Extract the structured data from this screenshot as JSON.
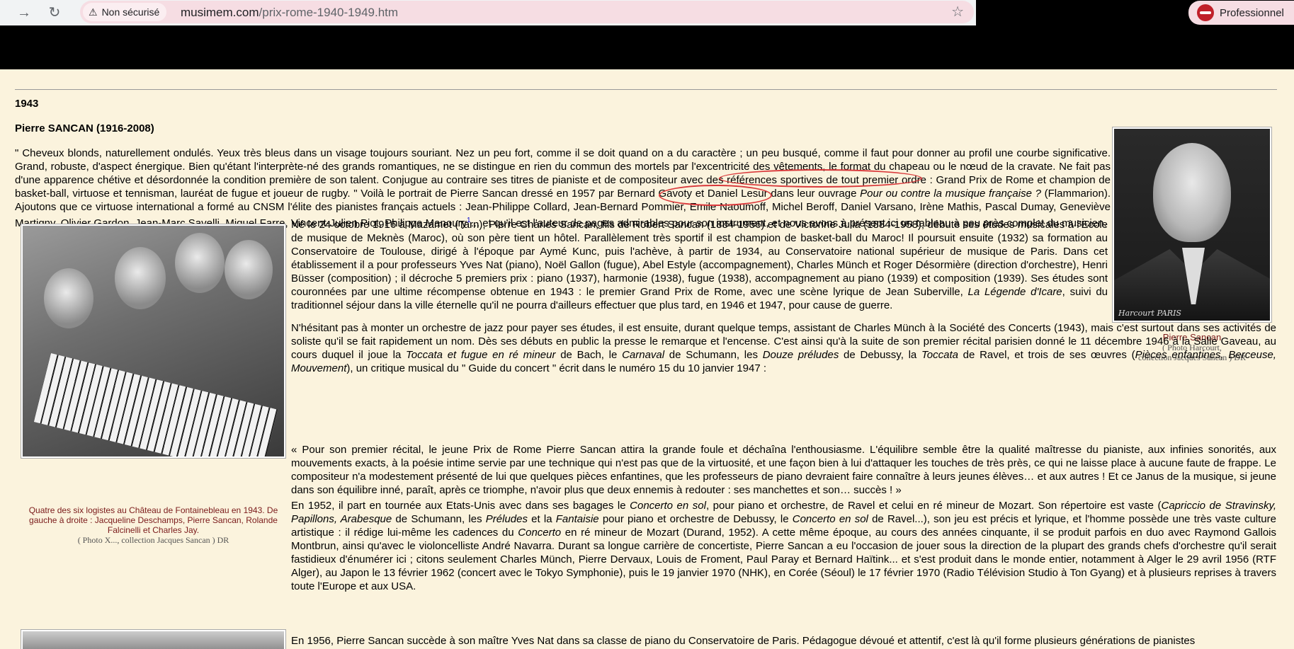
{
  "browser": {
    "security_label": "Non sécurisé",
    "url_host": "musimem.com",
    "url_path": "/prix-rome-1940-1949.htm",
    "profile_label": "Professionnel",
    "icons": [
      "forward-icon",
      "reload-icon",
      "warning-icon",
      "star-icon"
    ]
  },
  "page": {
    "year": "1943",
    "laureate": "Pierre SANCAN (1916-2008)",
    "intro": {
      "t1": "\" Cheveux blonds, naturellement ondulés. Yeux très bleus dans un visage toujours souriant. Nez un peu fort, comme il se doit quand on a du caractère ; un peu busqué, comme il faut pour donner au profil une courbe significative. Grand, robuste, d'aspect énergique. Bien qu'étant l'interprète-né des grands romantiques, ne se distingue en rien du commun des mortels par l'excentricité des vêtements, le format du chapeau ou le nœud de la cravate. Ne fait pas d'une apparence chétive et désordonnée la condition première de son talent. Conjugue au contraire ses titres de pianiste et de compositeur avec des références sportives de tout premier ordre : Grand Prix de Rome et champion de basket-ball, virtuose et tennisman, lauréat de fugue et joueur de rugby. \" Voilà le portrait de Pierre Sancan dressé en 1957 par Bernard Gavoty et Daniel Lesur dans leur ouvrage ",
      "book": "Pour ou contre la musique française ?",
      "t2": " (Flammarion). Ajoutons que ce virtuose international a formé au CNSM l'élite des pianistes français actuels : Jean-Philippe Collard, Jean-Bernard Pommier, Emile Naoumoff, Michel Beroff, Daniel Varsano, Irène Mathis, Pascal Dumay, Geneviève Martigny, Olivier Gardon, Jean-Marc Savelli, Miquel Farre, Vincent-Julien Piot, Philippe Manoury",
      "footnote": "1",
      "t3": "... et qu'il est l'auteur de pages admirables pour son instrument, et nous avons à présent ici un tableau à peu près complet du musicien."
    },
    "portrait": {
      "signature": "Harcourt PARIS",
      "caption_name": "Pierre Sancan",
      "caption_credit1": "( Photo Harcourt,",
      "caption_credit2": "collection Jacques Sancan ) DR"
    },
    "bio": {
      "t1": "Né le 24 octobre 1916 à Mazamet (Tarn), Pierre Charles Sancan, fils de Robert Sancan (1884-1956) et de Victorine Julia (1884-1958), débute ses études musicales à l'Ecole de musique de Meknès (Maroc), où son père tient un hôtel. Parallèlement très sportif il est champion de basket-ball du Maroc! Il poursuit ensuite (1932) sa formation au Conservatoire de Toulouse, dirigé à l'époque par Aymé Kunc, puis l'achève, à partir de 1934, au Conservatoire national supérieur de musique de Paris. Dans cet établissement il a pour professeurs Yves Nat (piano), Noël Gallon (fugue), Abel Estyle (accompagnement), Charles Münch et Roger Désormière (direction d'orchestre), Henri Büsser (composition) ; il décroche 5 premiers prix : piano (1937), harmonie (1938), fugue (1938), accompagnement au piano (1939) et composition (1939). Ses études sont couronnées par une ultime récompense obtenue en 1943 : le premier Grand Prix de Rome, avec une scène lyrique de Jean Suberville, ",
      "work": "La Légende d'Icare",
      "t2": ", suivi du traditionnel séjour dans la ville éternelle qu'il ne pourra d'ailleurs effectuer que plus tard, en 1946 et 1947, pour cause de guerre."
    },
    "jazz": {
      "t1": "N'hésitant pas à monter un orchestre de jazz pour payer ses études, il est ensuite, durant quelque temps, assistant de Charles Münch à la Société des Concerts (1943), mais c'est surtout dans ses activités de soliste qu'il se fait rapidement un nom. Dès ses débuts en public la presse le remarque et l'encense. C'est ainsi qu'à la suite de son premier récital parisien donné le 11 décembre 1946 à la Salle Gaveau, au cours duquel il joue la ",
      "w1": "Toccata et fugue en ré mineur",
      "t2": " de Bach, le ",
      "w2": "Carnaval",
      "t3": " de Schumann, les ",
      "w3": "Douze préludes",
      "t4": " de Debussy, la ",
      "w4": "Toccata",
      "t5": " de Ravel, et trois de ses œuvres (",
      "w5": "Pièces enfantines, Berceuse, Mouvement",
      "t6": "), un critique musical du \" Guide du concert \" écrit dans le numéro 15 du 10 janvier 1947 :"
    },
    "quote": "« Pour son premier récital, le jeune Prix de Rome Pierre Sancan attira la grande foule et déchaîna l'enthousiasme. L'équilibre semble être la qualité maîtresse du pianiste, aux infinies sonorités, aux mouvements exacts, à la poésie intime servie par une technique qui n'est pas que de la virtuosité, et une façon bien à lui d'attaquer les touches de très près, ce qui ne laisse place à aucune faute de frappe. Le compositeur n'a modestement présenté de lui que quelques pièces enfantines, que les professeurs de piano devraient faire connaître à leurs jeunes élèves… et aux autres ! Et ce Janus de la musique, si jeune dans son équilibre inné, paraît, après ce triomphe, n'avoir plus que deux ennemis à redouter : ses manchettes et son… succès ! »",
    "photo2": {
      "caption": "Quatre des six logistes au Château de Fontainebleau en 1943. De gauche à droite : Jacqueline Deschamps, Pierre Sancan, Rolande Falcinelli et Charles Jay.",
      "credit": "( Photo X..., collection Jacques Sancan ) DR"
    },
    "tour": {
      "t1": "En 1952, il part en tournée aux Etats-Unis avec dans ses bagages le ",
      "w1": "Concerto en sol",
      "t2": ", pour piano et orchestre, de Ravel et celui en ré mineur de Mozart. Son répertoire est vaste (",
      "w2": "Capriccio de Stravinsky, Papillons, Arabesque",
      "t3": " de Schumann, les ",
      "w3": "Préludes",
      "t4": " et la ",
      "w4": "Fantaisie",
      "t5": " pour piano et orchestre de Debussy, le ",
      "w5": "Concerto en sol",
      "t6": " de Ravel...), son jeu est précis et lyrique, et l'homme possède une très vaste culture artistique : il rédige lui-même les cadences du ",
      "w6": "Concerto",
      "t7": " en ré mineur de Mozart (Durand, 1952). A cette même époque, au cours des années cinquante, il se produit parfois en duo avec Raymond Gallois Montbrun, ainsi qu'avec le violoncelliste André Navarra. Durant sa longue carrière de concertiste, Pierre Sancan a eu l'occasion de jouer sous la direction de la plupart des grands chefs d'orchestre qu'il serait fastidieux d'énumérer ici ; citons seulement Charles Münch, Pierre Dervaux, Louis de Froment, Paul Paray et Bernard Haïtink... et s'est produit dans le monde entier, notamment à Alger le 29 avril 1956 (RTF Alger), au Japon le 13 février 1962 (concert avec le Tokyo Symphonie), puis le 19 janvier 1970 (NHK), en Corée (Séoul) le 17 février 1970 (Radio Télévision Studio à Ton Gyang) et à plusieurs reprises à travers toute l'Europe et aux USA."
    },
    "last": "En 1956, Pierre Sancan succède à son maître Yves Nat dans sa classe de piano du Conservatoire de Paris. Pédagogue dévoué et attentif, c'est là qu'il forme plusieurs générations de pianistes"
  }
}
